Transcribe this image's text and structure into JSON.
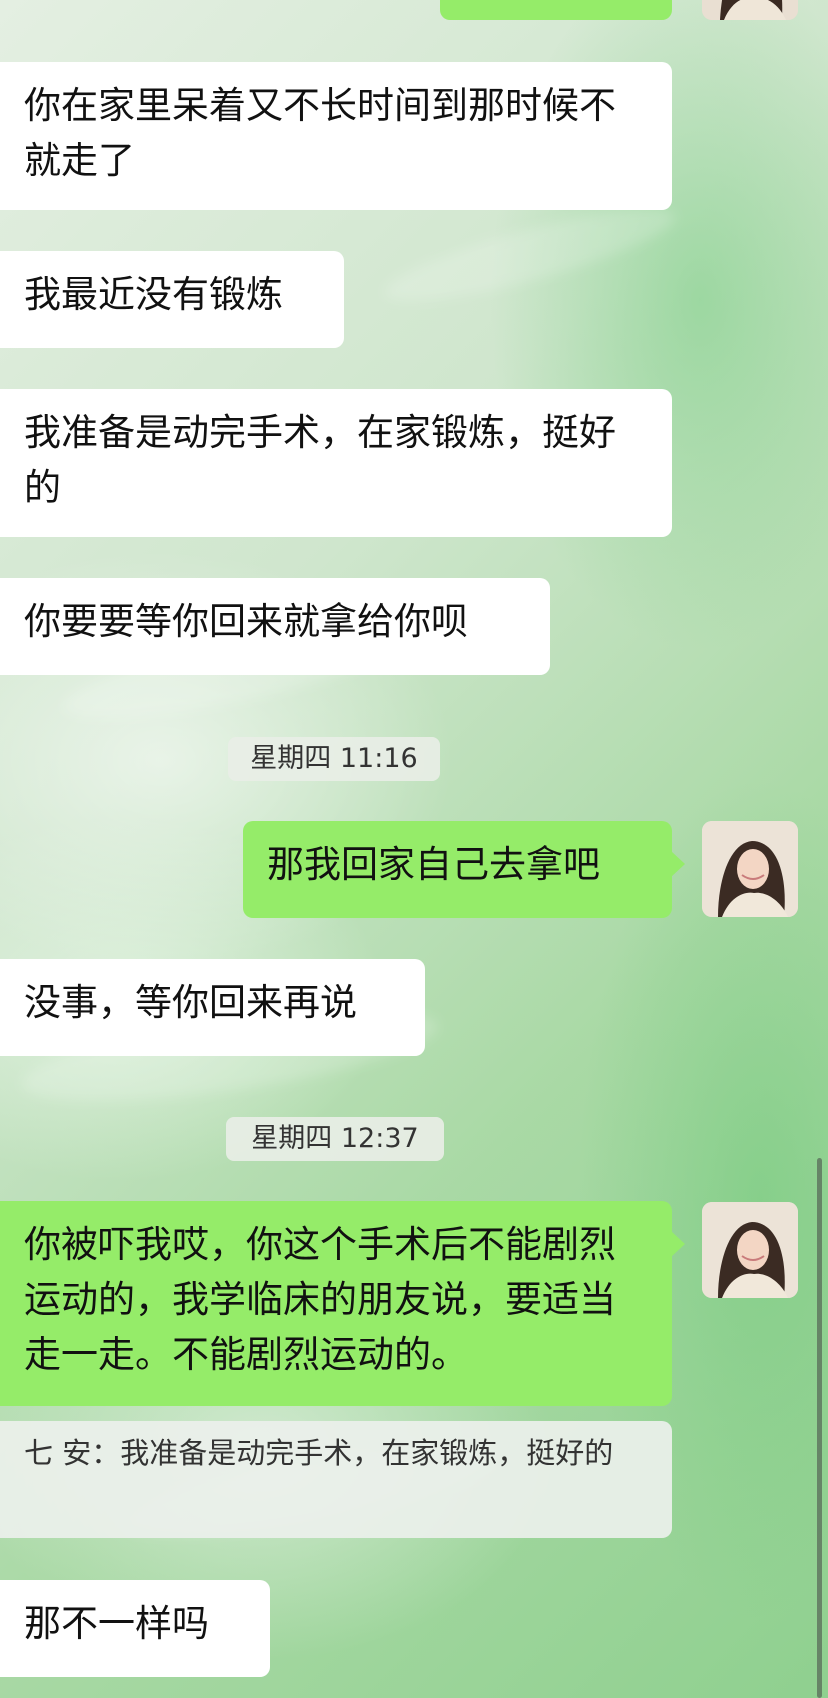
{
  "messages": {
    "m0": {
      "text": "你在家里呆着又不长时间到那时候不就走了"
    },
    "m1": {
      "text": "我最近没有锻炼"
    },
    "m2": {
      "text": "我准备是动完手术，在家锻炼，挺好的"
    },
    "m3": {
      "text": "你要要等你回来就拿给你呗"
    },
    "t1": {
      "text": "星期四 11:16"
    },
    "m4": {
      "text": "那我回家自己去拿吧"
    },
    "m5": {
      "text": "没事，等你回来再说"
    },
    "t2": {
      "text": "星期四 12:37"
    },
    "m6": {
      "text": "你被吓我哎，你这个手术后不能剧烈运动的，我学临床的朋友说，要适当走一走。不能剧烈运动的。"
    },
    "q1": {
      "text": "七 安：我准备是动完手术，在家锻炼，挺好的"
    },
    "m7": {
      "text": "那不一样吗"
    }
  },
  "colors": {
    "outgoing_bubble": "#95ec69",
    "incoming_bubble": "#ffffff",
    "timestamp_bg": "#e8eee6"
  },
  "icons": {
    "avatar": "user-avatar-photo"
  }
}
